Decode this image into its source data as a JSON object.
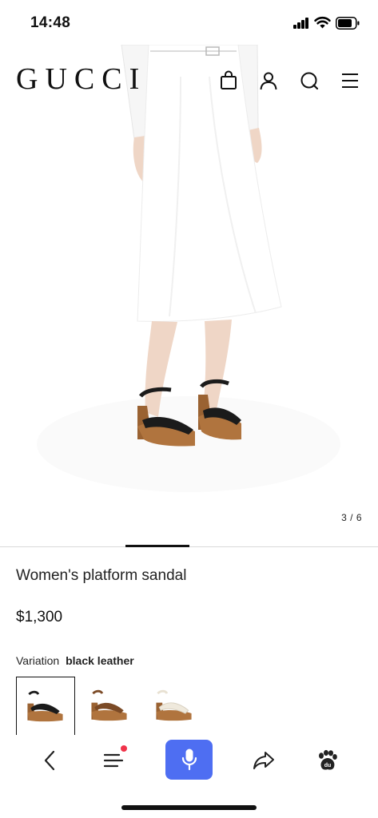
{
  "status": {
    "time": "14:48"
  },
  "header": {
    "logo": "GUCCI",
    "icons": [
      "shopping-bag-icon",
      "user-icon",
      "search-icon",
      "menu-icon"
    ]
  },
  "gallery": {
    "counter": "3 / 6",
    "current": 3,
    "total": 6
  },
  "product": {
    "name": "Women's platform sandal",
    "price": "$1,300",
    "variation_label": "Variation",
    "variation_value": "black leather",
    "swatches": [
      {
        "name": "black leather",
        "selected": true
      },
      {
        "name": "brown leather",
        "selected": false
      },
      {
        "name": "white leather",
        "selected": false
      }
    ]
  },
  "browser_bar": {
    "icons": [
      "back-icon",
      "menu-list-icon",
      "microphone-icon",
      "share-icon",
      "baidu-paw-icon"
    ],
    "accent_color": "#4e6ef2",
    "notification_color": "#f0334a"
  }
}
